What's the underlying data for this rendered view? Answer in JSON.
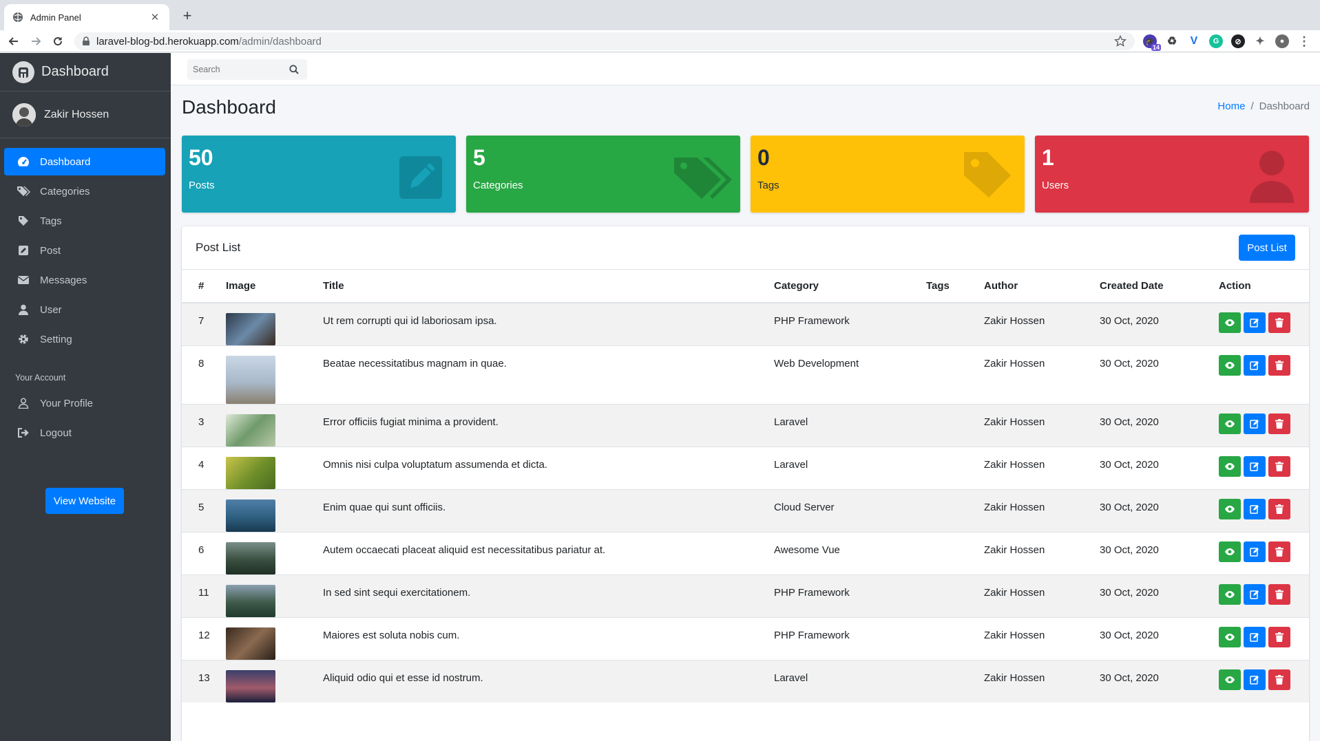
{
  "browser": {
    "tab_title": "Admin Panel",
    "url_host": "laravel-blog-bd.herokuapp.com",
    "url_path": "/admin/dashboard",
    "extension_badge": "14"
  },
  "sidebar": {
    "brand": "Dashboard",
    "user_name": "Zakir Hossen",
    "items": [
      {
        "label": "Dashboard",
        "icon": "tachometer-icon"
      },
      {
        "label": "Categories",
        "icon": "tags-icon"
      },
      {
        "label": "Tags",
        "icon": "tag-icon"
      },
      {
        "label": "Post",
        "icon": "edit-square-icon"
      },
      {
        "label": "Messages",
        "icon": "envelope-icon"
      },
      {
        "label": "User",
        "icon": "user-icon"
      },
      {
        "label": "Setting",
        "icon": "gear-icon"
      }
    ],
    "account_header": "Your Account",
    "account_items": [
      {
        "label": "Your Profile",
        "icon": "user-outline-icon"
      },
      {
        "label": "Logout",
        "icon": "sign-out-icon"
      }
    ],
    "view_website": "View Website"
  },
  "topnav": {
    "search_placeholder": "Search"
  },
  "header": {
    "title": "Dashboard",
    "breadcrumb": [
      "Home",
      "/",
      "Dashboard"
    ]
  },
  "stats": [
    {
      "value": "50",
      "label": "Posts",
      "color": "#17a2b8",
      "icon": "edit-icon"
    },
    {
      "value": "5",
      "label": "Categories",
      "color": "#28a745",
      "icon": "tags-icon"
    },
    {
      "value": "0",
      "label": "Tags",
      "color": "#ffc107",
      "icon": "tag-icon"
    },
    {
      "value": "1",
      "label": "Users",
      "color": "#dc3545",
      "icon": "user-icon"
    }
  ],
  "post_list": {
    "title": "Post List",
    "button": "Post List",
    "columns": [
      "#",
      "Image",
      "Title",
      "Category",
      "Tags",
      "Author",
      "Created Date",
      "Action"
    ],
    "rows": [
      {
        "id": "7",
        "title": "Ut rem corrupti qui id laboriosam ipsa.",
        "category": "PHP Framework",
        "tags": "",
        "author": "Zakir Hossen",
        "date": "30 Oct, 2020"
      },
      {
        "id": "8",
        "title": "Beatae necessitatibus magnam in quae.",
        "category": "Web Development",
        "tags": "",
        "author": "Zakir Hossen",
        "date": "30 Oct, 2020"
      },
      {
        "id": "3",
        "title": "Error officiis fugiat minima a provident.",
        "category": "Laravel",
        "tags": "",
        "author": "Zakir Hossen",
        "date": "30 Oct, 2020"
      },
      {
        "id": "4",
        "title": "Omnis nisi culpa voluptatum assumenda et dicta.",
        "category": "Laravel",
        "tags": "",
        "author": "Zakir Hossen",
        "date": "30 Oct, 2020"
      },
      {
        "id": "5",
        "title": "Enim quae qui sunt officiis.",
        "category": "Cloud Server",
        "tags": "",
        "author": "Zakir Hossen",
        "date": "30 Oct, 2020"
      },
      {
        "id": "6",
        "title": "Autem occaecati placeat aliquid est necessitatibus pariatur at.",
        "category": "Awesome Vue",
        "tags": "",
        "author": "Zakir Hossen",
        "date": "30 Oct, 2020"
      },
      {
        "id": "11",
        "title": "In sed sint sequi exercitationem.",
        "category": "PHP Framework",
        "tags": "",
        "author": "Zakir Hossen",
        "date": "30 Oct, 2020"
      },
      {
        "id": "12",
        "title": "Maiores est soluta nobis cum.",
        "category": "PHP Framework",
        "tags": "",
        "author": "Zakir Hossen",
        "date": "30 Oct, 2020"
      },
      {
        "id": "13",
        "title": "Aliquid odio qui et esse id nostrum.",
        "category": "Laravel",
        "tags": "",
        "author": "Zakir Hossen",
        "date": "30 Oct, 2020"
      }
    ]
  }
}
